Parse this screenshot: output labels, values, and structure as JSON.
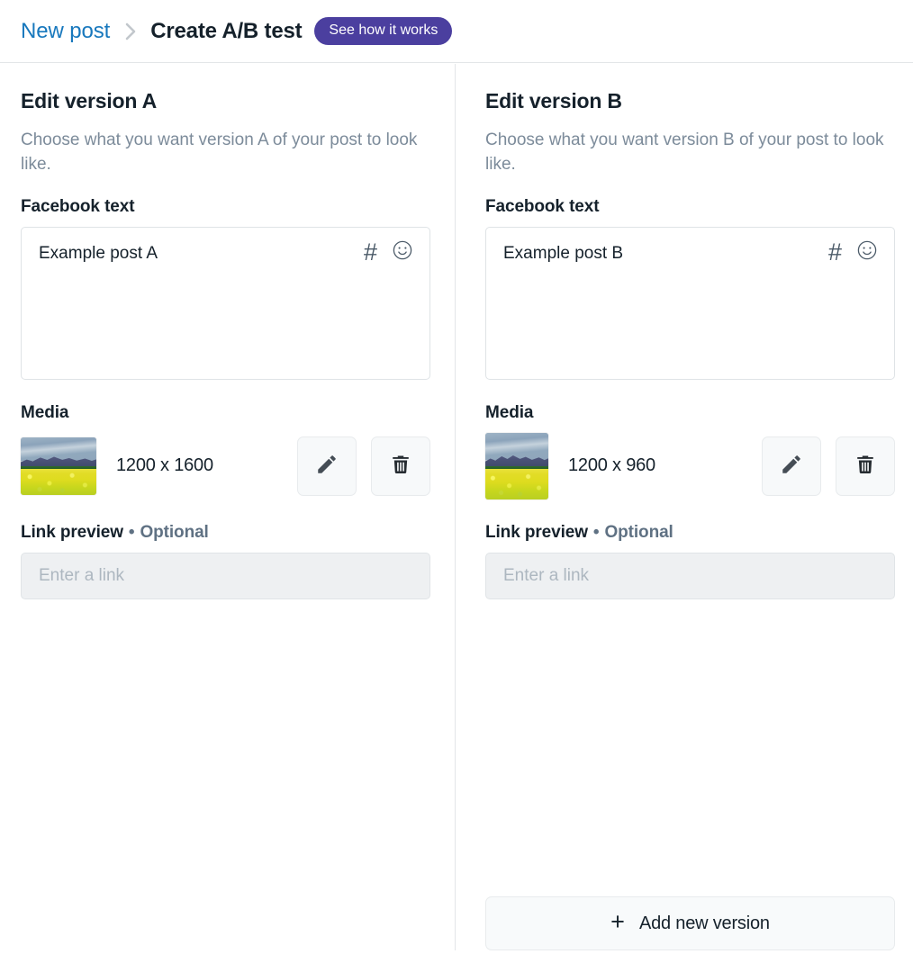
{
  "header": {
    "breadcrumb_link": "New post",
    "separator_icon": "chevron-right-icon",
    "breadcrumb_current": "Create A/B test",
    "pill_label": "See how it works",
    "pill_color": "#4b3f9f",
    "link_color": "#1878bd"
  },
  "versions": [
    {
      "title": "Edit version A",
      "subtitle": "Choose what you want version A of your post to look like.",
      "text_field_label": "Facebook text",
      "text_value": "Example post A",
      "hash_icon": "hashtag-icon",
      "emoji_icon": "smiley-icon",
      "media_label": "Media",
      "media_size": "1200 x 1600",
      "media_orientation": "landscape",
      "edit_icon": "pencil-icon",
      "delete_icon": "trash-icon",
      "link_label": "Link preview",
      "link_optional": "Optional",
      "link_placeholder": "Enter a link",
      "link_value": ""
    },
    {
      "title": "Edit version B",
      "subtitle": "Choose what you want version B of your post to look like.",
      "text_field_label": "Facebook text",
      "text_value": "Example post B",
      "hash_icon": "hashtag-icon",
      "emoji_icon": "smiley-icon",
      "media_label": "Media",
      "media_size": "1200 x 960",
      "media_orientation": "portrait",
      "edit_icon": "pencil-icon",
      "delete_icon": "trash-icon",
      "link_label": "Link preview",
      "link_optional": "Optional",
      "link_placeholder": "Enter a link",
      "link_value": ""
    }
  ],
  "footer": {
    "add_version_label": "Add new version",
    "add_icon": "plus-icon"
  }
}
